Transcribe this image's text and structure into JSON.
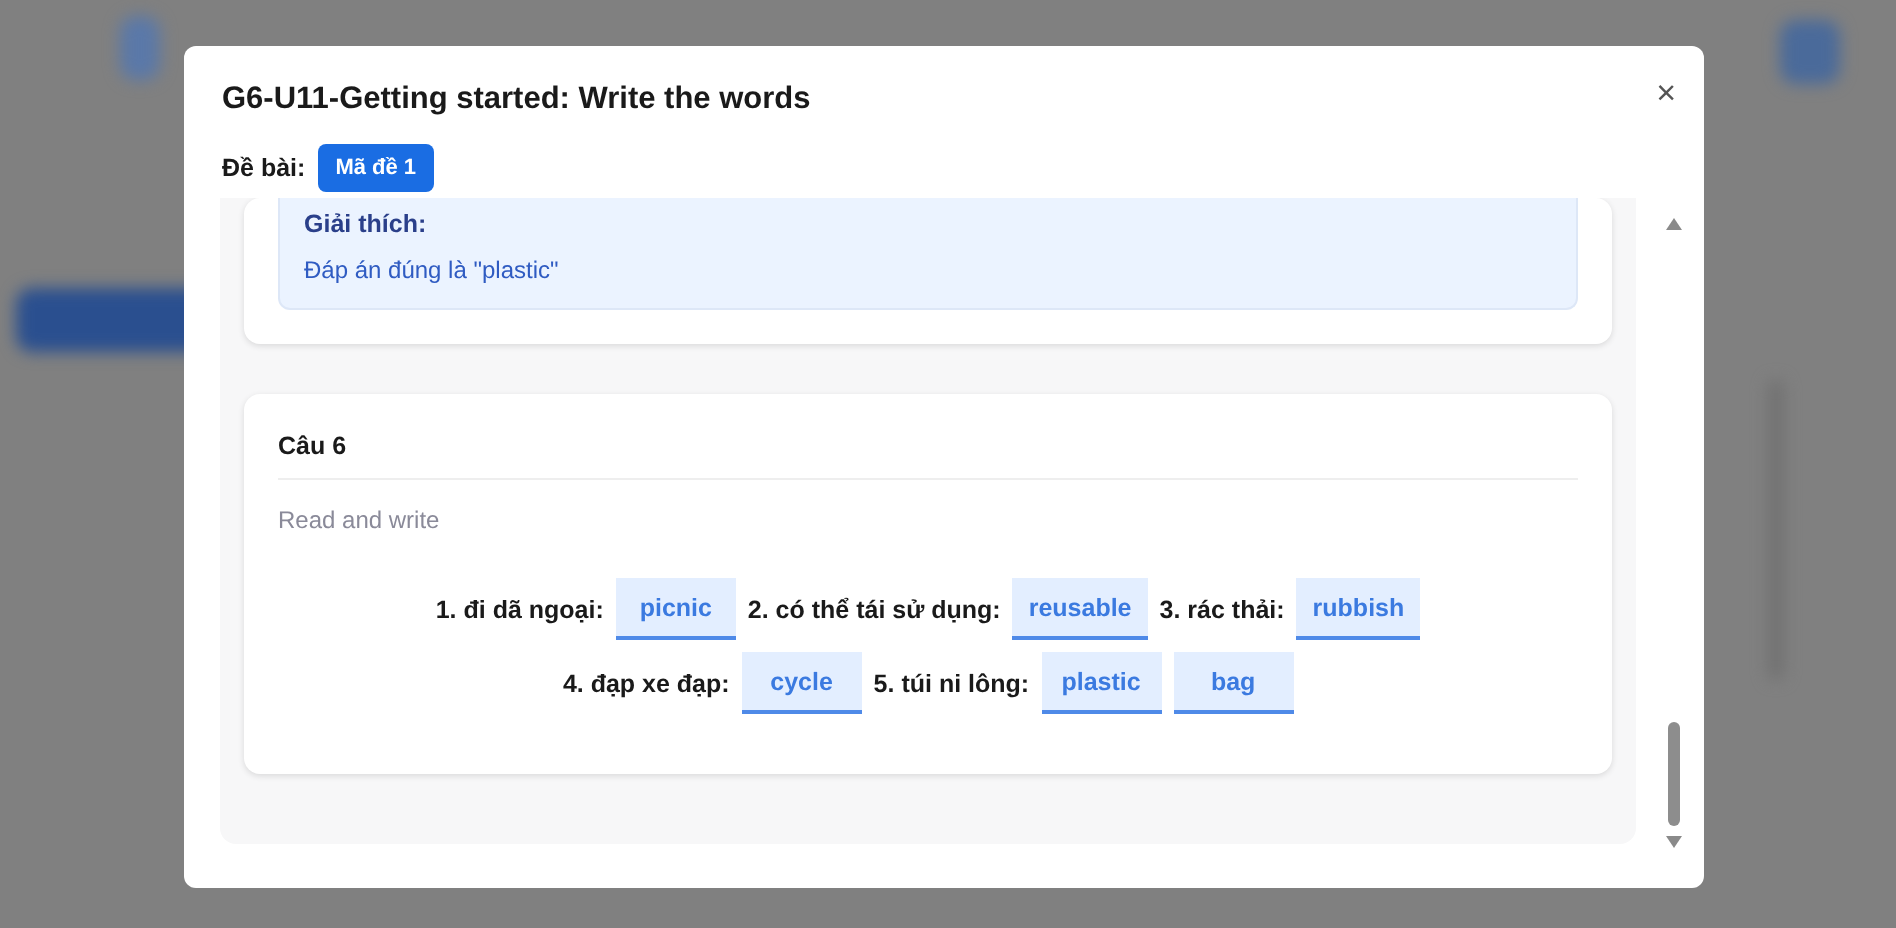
{
  "dialog": {
    "title": "G6-U11-Getting started: Write the words",
    "close": "×",
    "exam_label": "Đề bài:",
    "exam_tags": [
      {
        "label": "Mã đề 1",
        "selected": true
      }
    ]
  },
  "previous_question": {
    "explanation_title": "Giải thích:",
    "explanation": "Đáp án đúng là \"plastic\""
  },
  "question": {
    "title": "Câu 6",
    "instruction": "Read and write",
    "items": [
      {
        "kind": "label",
        "text": "1. đi dã ngoại:"
      },
      {
        "kind": "answer",
        "text": "picnic"
      },
      {
        "kind": "label",
        "text": "2. có thể tái sử dụng:"
      },
      {
        "kind": "answer",
        "text": "reusable"
      },
      {
        "kind": "label",
        "text": "3. rác thải:"
      },
      {
        "kind": "answer",
        "text": "rubbish"
      },
      {
        "kind": "label",
        "text": "4. đạp xe đạp:"
      },
      {
        "kind": "answer",
        "text": "cycle"
      },
      {
        "kind": "label",
        "text": "5. túi ni lông:"
      },
      {
        "kind": "answer",
        "text": "plastic"
      },
      {
        "kind": "answer",
        "text": "bag"
      }
    ]
  }
}
